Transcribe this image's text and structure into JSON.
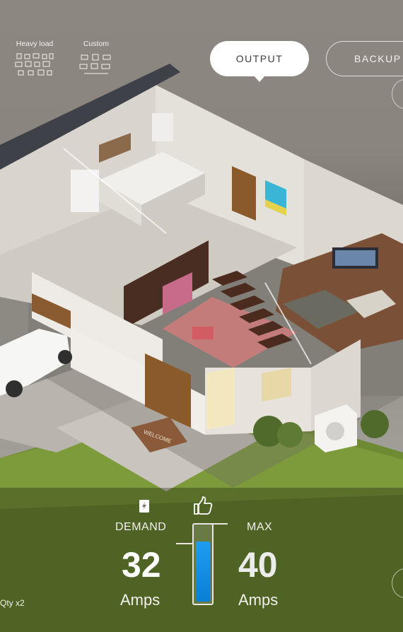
{
  "modes": [
    {
      "label": "Heavy load",
      "icon": "appliance-group-icon"
    },
    {
      "label": "Custom",
      "icon": "appliance-group-icon"
    }
  ],
  "tabs": [
    {
      "label": "OUTPUT",
      "selected": true
    },
    {
      "label": "BACKUP",
      "selected": false
    }
  ],
  "scene": {
    "doormat_text": "WELCOME"
  },
  "meter": {
    "demand_label": "DEMAND",
    "demand_value": "32",
    "demand_unit": "Amps",
    "max_label": "MAX",
    "max_value": "40",
    "max_unit": "Amps",
    "fill_fraction": 0.8,
    "fill_color": "#1590e6",
    "demand_icon": "document-bolt-icon",
    "status_icon": "thumbs-up-icon"
  },
  "footer": {
    "qty_text": "Qty x2"
  },
  "colors": {
    "accent": "#1590e6",
    "pill": "#ffffff",
    "text": "#f4f1ec"
  }
}
